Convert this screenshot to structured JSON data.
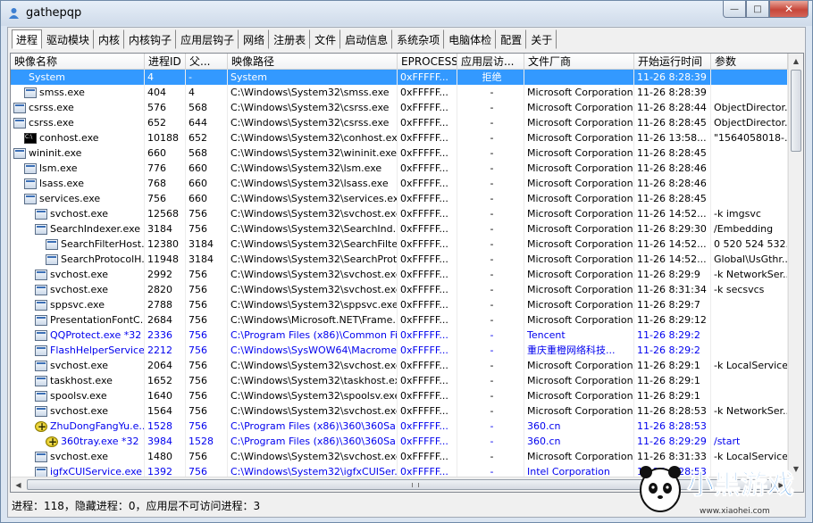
{
  "window": {
    "title": "gathepqp",
    "close_glyph": "✕",
    "minimize_glyph": "—",
    "maximize_glyph": "□"
  },
  "tabs": [
    "进程",
    "驱动模块",
    "内核",
    "内核钩子",
    "应用层钩子",
    "网络",
    "注册表",
    "文件",
    "启动信息",
    "系统杂项",
    "电脑体检",
    "配置",
    "关于"
  ],
  "columns": [
    "映像名称",
    "进程ID",
    "父...",
    "映像路径",
    "EPROCESS",
    "应用层访...",
    "文件厂商",
    "开始运行时间",
    "参数"
  ],
  "rows": [
    {
      "name": "System",
      "pid": "4",
      "ppid": "-",
      "path": "System",
      "eprocess": "0xFFFFF...",
      "access": "拒绝",
      "vendor": "",
      "time": "11-26 8:28:39",
      "params": "",
      "indent": 0,
      "icon": "none",
      "style": "sel"
    },
    {
      "name": "smss.exe",
      "pid": "404",
      "ppid": "4",
      "path": "C:\\Windows\\System32\\smss.exe",
      "eprocess": "0xFFFFF...",
      "access": "-",
      "vendor": "Microsoft Corporation",
      "time": "11-26 8:28:39",
      "params": "",
      "indent": 1,
      "icon": "window",
      "style": ""
    },
    {
      "name": "csrss.exe",
      "pid": "576",
      "ppid": "568",
      "path": "C:\\Windows\\System32\\csrss.exe",
      "eprocess": "0xFFFFF...",
      "access": "-",
      "vendor": "Microsoft Corporation",
      "time": "11-26 8:28:44",
      "params": "ObjectDirector...",
      "indent": 0,
      "icon": "window",
      "style": ""
    },
    {
      "name": "csrss.exe",
      "pid": "652",
      "ppid": "644",
      "path": "C:\\Windows\\System32\\csrss.exe",
      "eprocess": "0xFFFFF...",
      "access": "-",
      "vendor": "Microsoft Corporation",
      "time": "11-26 8:28:45",
      "params": "ObjectDirector...",
      "indent": 0,
      "icon": "window",
      "style": ""
    },
    {
      "name": "conhost.exe",
      "pid": "10188",
      "ppid": "652",
      "path": "C:\\Windows\\System32\\conhost.exe",
      "eprocess": "0xFFFFF...",
      "access": "-",
      "vendor": "Microsoft Corporation",
      "time": "11-26 13:58...",
      "params": "\"1564058018-...",
      "indent": 1,
      "icon": "cmd",
      "style": ""
    },
    {
      "name": "wininit.exe",
      "pid": "660",
      "ppid": "568",
      "path": "C:\\Windows\\System32\\wininit.exe",
      "eprocess": "0xFFFFF...",
      "access": "-",
      "vendor": "Microsoft Corporation",
      "time": "11-26 8:28:45",
      "params": "",
      "indent": 0,
      "icon": "window",
      "style": ""
    },
    {
      "name": "lsm.exe",
      "pid": "776",
      "ppid": "660",
      "path": "C:\\Windows\\System32\\lsm.exe",
      "eprocess": "0xFFFFF...",
      "access": "-",
      "vendor": "Microsoft Corporation",
      "time": "11-26 8:28:46",
      "params": "",
      "indent": 1,
      "icon": "window",
      "style": ""
    },
    {
      "name": "lsass.exe",
      "pid": "768",
      "ppid": "660",
      "path": "C:\\Windows\\System32\\lsass.exe",
      "eprocess": "0xFFFFF...",
      "access": "-",
      "vendor": "Microsoft Corporation",
      "time": "11-26 8:28:46",
      "params": "",
      "indent": 1,
      "icon": "window",
      "style": ""
    },
    {
      "name": "services.exe",
      "pid": "756",
      "ppid": "660",
      "path": "C:\\Windows\\System32\\services.exe",
      "eprocess": "0xFFFFF...",
      "access": "-",
      "vendor": "Microsoft Corporation",
      "time": "11-26 8:28:45",
      "params": "",
      "indent": 1,
      "icon": "window",
      "style": ""
    },
    {
      "name": "svchost.exe",
      "pid": "12568",
      "ppid": "756",
      "path": "C:\\Windows\\System32\\svchost.exe",
      "eprocess": "0xFFFFF...",
      "access": "-",
      "vendor": "Microsoft Corporation",
      "time": "11-26 14:52...",
      "params": "-k imgsvc",
      "indent": 2,
      "icon": "window",
      "style": ""
    },
    {
      "name": "SearchIndexer.exe",
      "pid": "3184",
      "ppid": "756",
      "path": "C:\\Windows\\System32\\SearchInd...",
      "eprocess": "0xFFFFF...",
      "access": "-",
      "vendor": "Microsoft Corporation",
      "time": "11-26 8:29:30",
      "params": "/Embedding",
      "indent": 2,
      "icon": "window",
      "style": ""
    },
    {
      "name": "SearchFilterHost...",
      "pid": "12380",
      "ppid": "3184",
      "path": "C:\\Windows\\System32\\SearchFilte...",
      "eprocess": "0xFFFFF...",
      "access": "-",
      "vendor": "Microsoft Corporation",
      "time": "11-26 14:52...",
      "params": "0 520 524 532...",
      "indent": 3,
      "icon": "window",
      "style": ""
    },
    {
      "name": "SearchProtocolH...",
      "pid": "11948",
      "ppid": "3184",
      "path": "C:\\Windows\\System32\\SearchProt...",
      "eprocess": "0xFFFFF...",
      "access": "-",
      "vendor": "Microsoft Corporation",
      "time": "11-26 14:52...",
      "params": "Global\\UsGthr...",
      "indent": 3,
      "icon": "window",
      "style": ""
    },
    {
      "name": "svchost.exe",
      "pid": "2992",
      "ppid": "756",
      "path": "C:\\Windows\\System32\\svchost.exe",
      "eprocess": "0xFFFFF...",
      "access": "-",
      "vendor": "Microsoft Corporation",
      "time": "11-26 8:29:9",
      "params": "-k NetworkSer...",
      "indent": 2,
      "icon": "window",
      "style": ""
    },
    {
      "name": "svchost.exe",
      "pid": "2820",
      "ppid": "756",
      "path": "C:\\Windows\\System32\\svchost.exe",
      "eprocess": "0xFFFFF...",
      "access": "-",
      "vendor": "Microsoft Corporation",
      "time": "11-26 8:31:34",
      "params": "-k secsvcs",
      "indent": 2,
      "icon": "window",
      "style": ""
    },
    {
      "name": "sppsvc.exe",
      "pid": "2788",
      "ppid": "756",
      "path": "C:\\Windows\\System32\\sppsvc.exe",
      "eprocess": "0xFFFFF...",
      "access": "-",
      "vendor": "Microsoft Corporation",
      "time": "11-26 8:29:7",
      "params": "",
      "indent": 2,
      "icon": "window",
      "style": ""
    },
    {
      "name": "PresentationFontC...",
      "pid": "2684",
      "ppid": "756",
      "path": "C:\\Windows\\Microsoft.NET\\Frame...",
      "eprocess": "0xFFFFF...",
      "access": "-",
      "vendor": "Microsoft Corporation",
      "time": "11-26 8:29:12",
      "params": "",
      "indent": 2,
      "icon": "window",
      "style": ""
    },
    {
      "name": "QQProtect.exe *32",
      "pid": "2336",
      "ppid": "756",
      "path": "C:\\Program Files (x86)\\Common Fil...",
      "eprocess": "0xFFFFF...",
      "access": "-",
      "vendor": "Tencent",
      "time": "11-26 8:29:2",
      "params": "",
      "indent": 2,
      "icon": "window",
      "style": "blue"
    },
    {
      "name": "FlashHelperService...",
      "pid": "2212",
      "ppid": "756",
      "path": "C:\\Windows\\SysWOW64\\Macrome...",
      "eprocess": "0xFFFFF...",
      "access": "-",
      "vendor": "重庆重橙网络科技...",
      "time": "11-26 8:29:2",
      "params": "",
      "indent": 2,
      "icon": "window",
      "style": "blue"
    },
    {
      "name": "svchost.exe",
      "pid": "2064",
      "ppid": "756",
      "path": "C:\\Windows\\System32\\svchost.exe",
      "eprocess": "0xFFFFF...",
      "access": "-",
      "vendor": "Microsoft Corporation",
      "time": "11-26 8:29:1",
      "params": "-k LocalService...",
      "indent": 2,
      "icon": "window",
      "style": ""
    },
    {
      "name": "taskhost.exe",
      "pid": "1652",
      "ppid": "756",
      "path": "C:\\Windows\\System32\\taskhost.exe",
      "eprocess": "0xFFFFF...",
      "access": "-",
      "vendor": "Microsoft Corporation",
      "time": "11-26 8:29:1",
      "params": "",
      "indent": 2,
      "icon": "window",
      "style": ""
    },
    {
      "name": "spoolsv.exe",
      "pid": "1640",
      "ppid": "756",
      "path": "C:\\Windows\\System32\\spoolsv.exe",
      "eprocess": "0xFFFFF...",
      "access": "-",
      "vendor": "Microsoft Corporation",
      "time": "11-26 8:29:1",
      "params": "",
      "indent": 2,
      "icon": "window",
      "style": ""
    },
    {
      "name": "svchost.exe",
      "pid": "1564",
      "ppid": "756",
      "path": "C:\\Windows\\System32\\svchost.exe",
      "eprocess": "0xFFFFF...",
      "access": "-",
      "vendor": "Microsoft Corporation",
      "time": "11-26 8:28:53",
      "params": "-k NetworkSer...",
      "indent": 2,
      "icon": "window",
      "style": ""
    },
    {
      "name": "ZhuDongFangYu.e...",
      "pid": "1528",
      "ppid": "756",
      "path": "C:\\Program Files (x86)\\360\\360Sa...",
      "eprocess": "0xFFFFF...",
      "access": "-",
      "vendor": "360.cn",
      "time": "11-26 8:28:53",
      "params": "",
      "indent": 2,
      "icon": "plus",
      "style": "blue"
    },
    {
      "name": "360tray.exe *32",
      "pid": "3984",
      "ppid": "1528",
      "path": "C:\\Program Files (x86)\\360\\360Sa...",
      "eprocess": "0xFFFFF...",
      "access": "-",
      "vendor": "360.cn",
      "time": "11-26 8:29:29",
      "params": "/start",
      "indent": 3,
      "icon": "plus",
      "style": "blue"
    },
    {
      "name": "svchost.exe",
      "pid": "1480",
      "ppid": "756",
      "path": "C:\\Windows\\System32\\svchost.exe",
      "eprocess": "0xFFFFF...",
      "access": "-",
      "vendor": "Microsoft Corporation",
      "time": "11-26 8:31:33",
      "params": "-k LocalService...",
      "indent": 2,
      "icon": "window",
      "style": ""
    },
    {
      "name": "igfxCUIService.exe",
      "pid": "1392",
      "ppid": "756",
      "path": "C:\\Windows\\System32\\igfxCUISer...",
      "eprocess": "0xFFFFF...",
      "access": "-",
      "vendor": "Intel Corporation",
      "time": "11-26 8:28:53",
      "params": "",
      "indent": 2,
      "icon": "window",
      "style": "blue"
    }
  ],
  "status": "进程：118，隐藏进程：0，应用层不可访问进程：3",
  "watermark": {
    "line1": "小黑游戏",
    "line2": "www.xiaohei.com"
  },
  "colors": {
    "selection": "#3399ff",
    "unsigned_text": "#0000ee",
    "watermark": "#1a7de0"
  }
}
